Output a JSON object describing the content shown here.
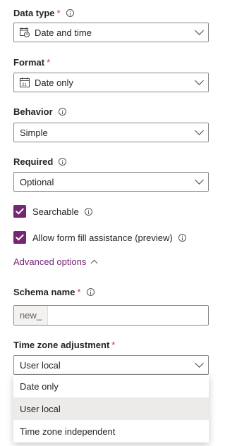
{
  "data_type": {
    "label": "Data type",
    "required": "*",
    "value": "Date and time",
    "icon": "calendar-clock-icon"
  },
  "format": {
    "label": "Format",
    "required": "*",
    "value": "Date only",
    "icon": "calendar-icon"
  },
  "behavior": {
    "label": "Behavior",
    "value": "Simple"
  },
  "required_field": {
    "label": "Required",
    "value": "Optional"
  },
  "searchable": {
    "label": "Searchable",
    "checked": true
  },
  "form_fill": {
    "label": "Allow form fill assistance (preview)",
    "checked": true
  },
  "advanced_options": {
    "label": "Advanced options"
  },
  "schema_name": {
    "label": "Schema name",
    "required": "*",
    "prefix": "new_",
    "value": ""
  },
  "time_zone": {
    "label": "Time zone adjustment",
    "required": "*",
    "value": "User local",
    "options": [
      "Date only",
      "User local",
      "Time zone independent"
    ],
    "selected_index": 1
  },
  "colors": {
    "accent": "#742774",
    "required": "#c4314b",
    "border": "#8a8886"
  }
}
